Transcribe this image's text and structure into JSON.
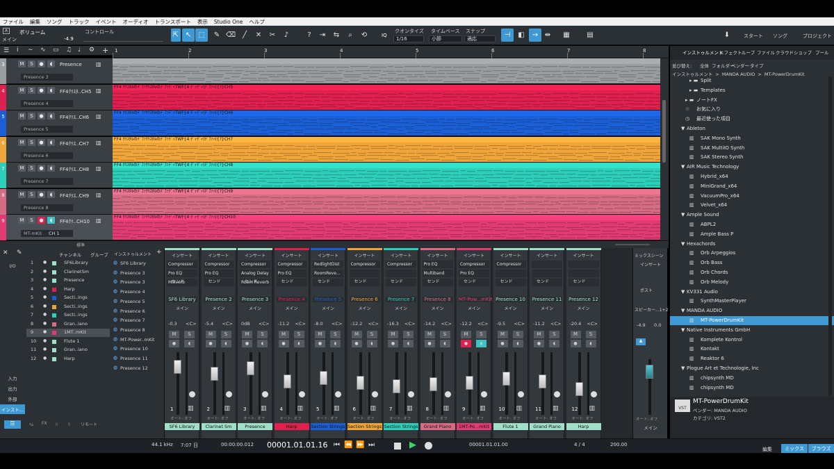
{
  "menu": [
    "ファイル",
    "編集",
    "ソング",
    "トラック",
    "イベント",
    "オーディオ",
    "トランスポート",
    "表示",
    "Studio One",
    "ヘルプ"
  ],
  "toolbar": {
    "param_label": "ボリューム",
    "param_value": "-4.9",
    "param_sub": "メイン",
    "controller_label": "コントロール",
    "quantize_label": "クオンタイズ",
    "quantize_value": "1/16",
    "timebase_label": "タイムベース",
    "timebase_value": "小節",
    "snap_label": "スナップ",
    "snap_value": "適応",
    "iq_label": "IQ",
    "start_label": "スタート",
    "song_label": "ソング",
    "project_label": "プロジェクト"
  },
  "ruler": [
    "1",
    "2",
    "3",
    "4",
    "5",
    "6",
    "7",
    "8"
  ],
  "tracks": [
    {
      "num": "3",
      "name": "Presence",
      "preset": "Presence 3",
      "color": "#9a9d9f",
      "cap": ""
    },
    {
      "num": "4",
      "name": "FF4ｸﾘｽﾀ..CH5",
      "preset": "Presence 4",
      "color": "#e0204f",
      "cap": "FF4 ｸﾘｽﾀﾙのﾃﾞﾌｧｸﾘｽﾀﾙのﾃﾞﾌｧﾃﾞｨTWF{4 ﾃﾞｨﾃﾞｨ(ﾃﾞﾌｧｨ({?}CH5"
    },
    {
      "num": "5",
      "name": "FF4ｸﾘｽ..CH6",
      "preset": "Presence 5",
      "color": "#1b5fd6",
      "cap": "FF4 ｸﾘｽﾀﾙのﾃﾞﾌｧｸﾘｽﾀﾙのﾃﾞﾌｧﾃﾞｨTWF{4 ﾃﾞｨﾃﾞｨ(ﾃﾞﾌｧｨ({?}CH6"
    },
    {
      "num": "6",
      "name": "FF4ｸﾘｽ..CH7",
      "preset": "Presence 6",
      "color": "#f0a53a",
      "cap": "FF4 ｸﾘｽﾀﾙのﾃﾞﾌｧｸﾘｽﾀﾙのﾃﾞﾌｧﾃﾞｨTWF{4 ﾃﾞｨﾃﾞｨ(ﾃﾞﾌｧｨ({?}CH7"
    },
    {
      "num": "7",
      "name": "FF4ｸﾘｽ..CH8",
      "preset": "Presence 7",
      "color": "#2dcfb9",
      "cap": "FF4 ｸﾘｽﾀﾙのﾃﾞﾌｧｸﾘｽﾀﾙのﾃﾞﾌｧﾃﾞｨTWF{4 ﾃﾞｨﾃﾞｨ(ﾃﾞﾌｧｨ({?}CH8"
    },
    {
      "num": "8",
      "name": "FF4ｸﾘｽ..CH9",
      "preset": "Presence 8",
      "color": "#d76b84",
      "cap": "FF4 ｸﾘｽﾀﾙのﾃﾞﾌｧｸﾘｽﾀﾙのﾃﾞﾌｧﾃﾞｨTWF{4 ﾃﾞｨﾃﾞｨ(ﾃﾞﾌｧｨ({?}CH9"
    },
    {
      "num": "9",
      "name": "FF4ｸﾘ..CH10",
      "preset": "MT-mKit",
      "color": "#e23b74",
      "cap": "FF4 ｸﾘｽﾀﾙのﾃﾞﾌｧｸﾘｽﾀﾙのﾃﾞﾌｧﾃﾞｨTWF{4 ﾃﾞｨﾃﾞｨ(ﾃﾞﾌｧｨ({?}CH10"
    }
  ],
  "track9_channel": "CH 1",
  "track_footer": "標準",
  "browser": {
    "tabs": [
      "インストゥルメント",
      "エフェクト",
      "ループ",
      "ファイル",
      "クラウド",
      "ショップ",
      "プール"
    ],
    "sort_label": "並び替え:",
    "sort_opts": [
      "全体",
      "フォルダー",
      "ベンダー",
      "タイプ"
    ],
    "path": [
      "インストゥルメント",
      ">",
      "MANDA AUDIO",
      ">",
      "MT-PowerDrumKit"
    ],
    "items": [
      {
        "t": "Split",
        "lv": 2,
        "ic": "folder"
      },
      {
        "t": "Templates",
        "lv": 2,
        "ic": "folder"
      },
      {
        "t": "ノートFX",
        "lv": 1,
        "ic": "folder"
      },
      {
        "t": "お気に入り",
        "lv": 1,
        "ic": "star"
      },
      {
        "t": "最近使った項目",
        "lv": 1,
        "ic": "clock"
      },
      {
        "t": "Ableton",
        "lv": 1,
        "ic": "tri"
      },
      {
        "t": "SAK Mono Synth",
        "lv": 2,
        "ic": "piano"
      },
      {
        "t": "SAK MultiIO Synth",
        "lv": 2,
        "ic": "piano"
      },
      {
        "t": "SAK Stereo Synth",
        "lv": 2,
        "ic": "piano"
      },
      {
        "t": "AIR Music Technology",
        "lv": 1,
        "ic": "tri"
      },
      {
        "t": "Hybrid_x64",
        "lv": 2,
        "ic": "piano"
      },
      {
        "t": "MiniGrand_x64",
        "lv": 2,
        "ic": "piano"
      },
      {
        "t": "VacuumPro_x64",
        "lv": 2,
        "ic": "piano"
      },
      {
        "t": "Velvet_x64",
        "lv": 2,
        "ic": "piano"
      },
      {
        "t": "Ample Sound",
        "lv": 1,
        "ic": "tri"
      },
      {
        "t": "ABPL2",
        "lv": 2,
        "ic": "piano"
      },
      {
        "t": "Ample Bass P",
        "lv": 2,
        "ic": "piano"
      },
      {
        "t": "Hexachords",
        "lv": 1,
        "ic": "tri"
      },
      {
        "t": "Orb Arpeggios",
        "lv": 2,
        "ic": "piano"
      },
      {
        "t": "Orb Bass",
        "lv": 2,
        "ic": "piano"
      },
      {
        "t": "Orb Chords",
        "lv": 2,
        "ic": "piano"
      },
      {
        "t": "Orb Melody",
        "lv": 2,
        "ic": "piano"
      },
      {
        "t": "KV331 Audio",
        "lv": 1,
        "ic": "tri"
      },
      {
        "t": "SynthMasterPlayer",
        "lv": 2,
        "ic": "piano"
      },
      {
        "t": "MANDA AUDIO",
        "lv": 1,
        "ic": "tri"
      },
      {
        "t": "MT-PowerDrumKit",
        "lv": 2,
        "ic": "piano",
        "sel": true
      },
      {
        "t": "Native Instruments GmbH",
        "lv": 1,
        "ic": "tri"
      },
      {
        "t": "Komplete Kontrol",
        "lv": 2,
        "ic": "piano"
      },
      {
        "t": "Kontakt",
        "lv": 2,
        "ic": "piano"
      },
      {
        "t": "Reaktor 6",
        "lv": 2,
        "ic": "piano"
      },
      {
        "t": "Plogue Art et Technologie, Inc",
        "lv": 1,
        "ic": "tri"
      },
      {
        "t": "chipsynth MD",
        "lv": 2,
        "ic": "piano"
      },
      {
        "t": "chipsynth MD",
        "lv": 2,
        "ic": "piano"
      }
    ],
    "info": {
      "title": "MT-PowerDrumKit",
      "vendor": "ベンダー:  MANDA AUDIO",
      "category": "カテゴリ:  VST2",
      "badge": "VST"
    }
  },
  "mixer_left": {
    "tab_channel": "チャンネル",
    "tab_group": "グループ",
    "tab_instr": "インストゥルメント",
    "side": [
      "I/O",
      "入力",
      "出力",
      "外部",
      "インスト..."
    ],
    "channels": [
      {
        "n": "1",
        "name": "SF6Library",
        "c": "#9fe0c7"
      },
      {
        "n": "2",
        "name": "ClarinetSm",
        "c": "#9fe0c7"
      },
      {
        "n": "3",
        "name": "Presence",
        "c": "#9fe0c7"
      },
      {
        "n": "4",
        "name": "Harp",
        "c": "#e0204f"
      },
      {
        "n": "5",
        "name": "Secti..ings",
        "c": "#1b5fd6"
      },
      {
        "n": "6",
        "name": "Secti..ings",
        "c": "#f0a53a"
      },
      {
        "n": "7",
        "name": "Secti..ings",
        "c": "#2dcfb9"
      },
      {
        "n": "8",
        "name": "Gran..iano",
        "c": "#d76b84"
      },
      {
        "n": "9",
        "name": "1MT..mKit",
        "c": "#e23b74"
      },
      {
        "n": "10",
        "name": "Flute 1",
        "c": "#9fe0c7"
      },
      {
        "n": "11",
        "name": "Gran..iano",
        "c": "#9fe0c7"
      },
      {
        "n": "12",
        "name": "Harp",
        "c": "#9fe0c7"
      }
    ],
    "instruments": [
      "SF6 Library",
      "Presence 3",
      "Presence 3",
      "Presence 4",
      "Presence 5",
      "Presence 6",
      "Presence 7",
      "Presence 8",
      "MT-Power..mKit",
      "Presence 10",
      "Presence 11",
      "Presence 12"
    ],
    "bottom": [
      "ﾍﾑ",
      "FX",
      "ﾊ",
      "ﾘ",
      "リモート"
    ]
  },
  "strips": [
    {
      "n": "1",
      "name": "SF6 Library",
      "vol": "-0.3",
      "label": "SF6 Library",
      "c": "#9fe0c7",
      "ins": [
        "Compressor",
        "Pro EQ",
        "Mixverb"
      ],
      "fader": 0.85
    },
    {
      "n": "2",
      "name": "Presence 2",
      "vol": "-5.4",
      "label": "Clarinet Sm",
      "c": "#9fe0c7",
      "ins": [
        "Compressor",
        "Pro EQ",
        ""
      ],
      "fader": 0.7
    },
    {
      "n": "3",
      "name": "Presence 3",
      "vol": "0dB",
      "label": "Presence",
      "c": "#9fe0c7",
      "ins": [
        "Compressor",
        "Analog Delay",
        "Room Reverb"
      ],
      "fader": 0.82
    },
    {
      "n": "4",
      "name": "Presence 4",
      "vol": "-11.2",
      "label": "Harp",
      "c": "#e0204f",
      "ins": [
        "Compressor",
        "Pro EQ",
        ""
      ],
      "fader": 0.55
    },
    {
      "n": "5",
      "name": "Presence 5",
      "vol": "-8.0",
      "label": "Section Strings",
      "c": "#1b5fd6",
      "ins": [
        "RedlightDist",
        "RoomReve...",
        ""
      ],
      "fader": 0.62
    },
    {
      "n": "6",
      "name": "Presence 6",
      "vol": "-12.2",
      "label": "Section Strings",
      "c": "#f0a53a",
      "ins": [
        "Compressor",
        "",
        ""
      ],
      "fader": 0.52
    },
    {
      "n": "7",
      "name": "Presence 7",
      "vol": "-16.3",
      "label": "Section Strings",
      "c": "#2dcfb9",
      "ins": [
        "Compressor",
        "",
        ""
      ],
      "fader": 0.45
    },
    {
      "n": "8",
      "name": "Presence 8",
      "vol": "-14.2",
      "label": "Grand Piano",
      "c": "#d76b84",
      "ins": [
        "Pro EQ",
        "Multiband",
        ""
      ],
      "fader": 0.48
    },
    {
      "n": "9",
      "name": "MT-Pow...mKit",
      "vol": "-12.2",
      "label": "1MT-Po...mKit",
      "c": "#e23b74",
      "ins": [
        "Compressor",
        "Pro EQ",
        ""
      ],
      "fader": 0.52
    },
    {
      "n": "10",
      "name": "Presence 10",
      "vol": "-9.5",
      "label": "Flute 1",
      "c": "#9fe0c7",
      "ins": [
        "Compressor",
        "",
        ""
      ],
      "fader": 0.6
    },
    {
      "n": "11",
      "name": "Presence 11",
      "vol": "-11.2",
      "label": "Grand Piano",
      "c": "#9fe0c7",
      "ins": [
        "",
        "",
        ""
      ],
      "fader": 0.55
    },
    {
      "n": "12",
      "name": "Presence 12",
      "vol": "-20.4",
      "label": "Harp",
      "c": "#9fe0c7",
      "ins": [
        "",
        "",
        ""
      ],
      "fader": 0.38
    }
  ],
  "strip_text": {
    "insert": "インサート",
    "send": "センド",
    "main": "メイン",
    "auto": "オート: オフ",
    "m": "M",
    "s": "S",
    "pan": "<C>"
  },
  "master": {
    "mix_scene": "ミックスシーン",
    "insert": "インサート",
    "post": "ポスト",
    "speaker": "スピーカー...1+2",
    "vol": "-4.9",
    "vol2": "0.0",
    "main": "メイン",
    "auto": "オート: オフ"
  },
  "transport": {
    "sample_rate": "44.1 kHz",
    "rate2": "5.6 ms",
    "time": "7:07 日",
    "time2": "1.1 MB",
    "clock": "00:00:00.012",
    "position": "00001.01.01.16",
    "loop1": "00001.01.01.00",
    "loop2": "00067.01.01.00",
    "sig": "4 / 4",
    "tempo": "200.00"
  },
  "bottom": {
    "edit": "編集",
    "mix": "ミックス",
    "browse": "ブラウズ"
  }
}
